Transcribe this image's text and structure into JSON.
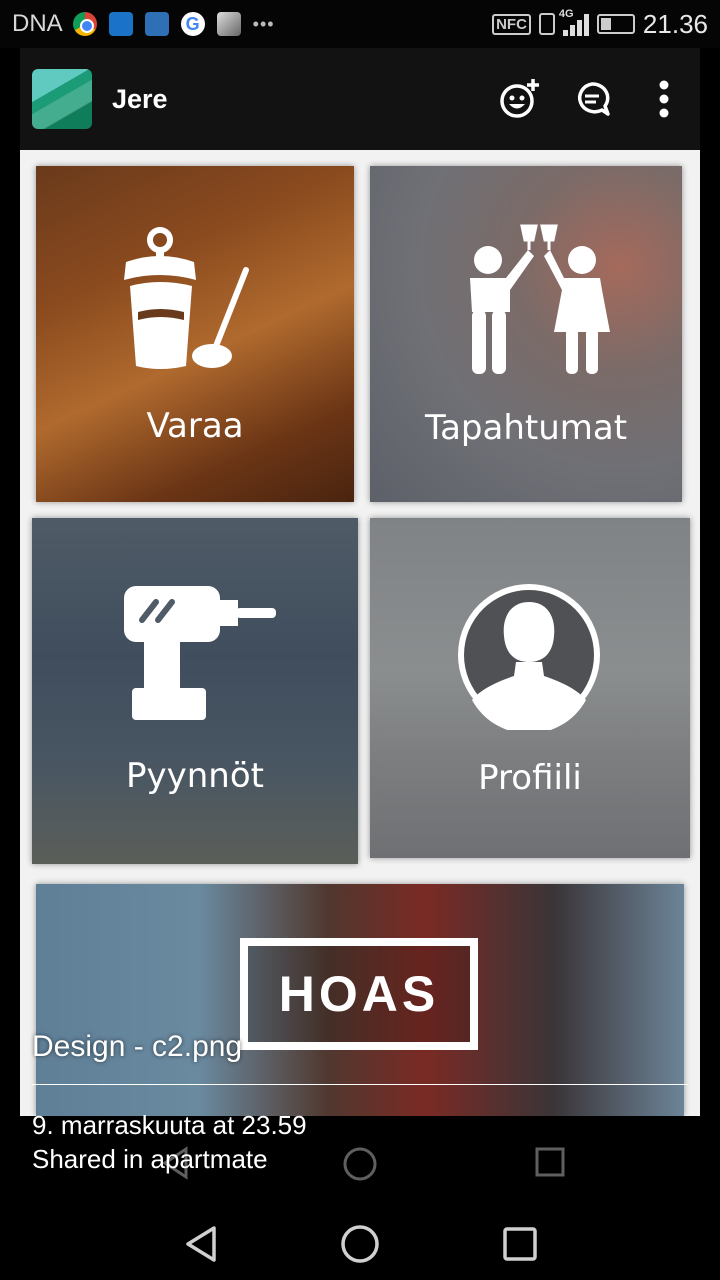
{
  "status_bar": {
    "carrier": "DNA",
    "icons": [
      "chrome-icon",
      "fb-icon",
      "app-icon",
      "google-icon",
      "photo-icon",
      "more-notifications-icon"
    ],
    "right_icons": [
      "nfc-icon",
      "vibrate-icon",
      "signal-icon",
      "battery-icon"
    ],
    "network": "4G",
    "nfc_label": "NFC",
    "time": "21.36"
  },
  "app_bar": {
    "title": "Jere",
    "actions": [
      "add-emoji-icon",
      "comment-icon",
      "more-options-icon"
    ]
  },
  "tiles": [
    {
      "label": "Varaa",
      "icon": "sauna-bucket-icon"
    },
    {
      "label": "Tapahtumat",
      "icon": "people-toast-icon"
    },
    {
      "label": "Pyynnöt",
      "icon": "drill-icon"
    },
    {
      "label": "Profiili",
      "icon": "profile-icon"
    },
    {
      "label": "HOAS",
      "icon": "hoas-logo"
    }
  ],
  "caption": {
    "title": "Design - c2.png",
    "date": "9. marraskuuta at 23.59",
    "shared": "Shared in apartmate"
  },
  "colors": {
    "appbar": "#121212",
    "card_background": "#f4f4f4",
    "status_bar": "#050505"
  }
}
